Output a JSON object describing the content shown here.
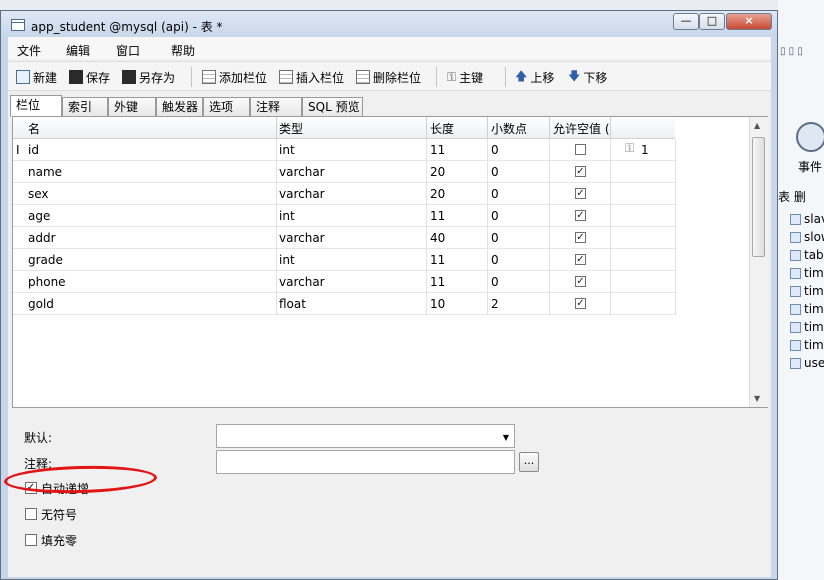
{
  "window": {
    "title": "app_student @mysql (api) - 表 *"
  },
  "window_controls": {
    "min": "—",
    "max": "□",
    "close": "×"
  },
  "menu": [
    "文件",
    "编辑",
    "窗口",
    "帮助"
  ],
  "toolbar": {
    "new": "新建",
    "save": "保存",
    "save_as": "另存为",
    "add_field": "添加栏位",
    "insert_field": "插入栏位",
    "delete_field": "删除栏位",
    "primary_key": "主键",
    "move_up": "上移",
    "move_down": "下移"
  },
  "tabs": [
    "栏位",
    "索引",
    "外键",
    "触发器",
    "选项",
    "注释",
    "SQL 预览"
  ],
  "active_tab": "栏位",
  "grid": {
    "columns": [
      "名",
      "类型",
      "长度",
      "小数点",
      "允许空值 ("
    ],
    "rows": [
      {
        "name": "id",
        "type": "int",
        "length": "11",
        "decimals": "0",
        "allow_null": false,
        "key": "1"
      },
      {
        "name": "name",
        "type": "varchar",
        "length": "20",
        "decimals": "0",
        "allow_null": true,
        "key": ""
      },
      {
        "name": "sex",
        "type": "varchar",
        "length": "20",
        "decimals": "0",
        "allow_null": true,
        "key": ""
      },
      {
        "name": "age",
        "type": "int",
        "length": "11",
        "decimals": "0",
        "allow_null": true,
        "key": ""
      },
      {
        "name": "addr",
        "type": "varchar",
        "length": "40",
        "decimals": "0",
        "allow_null": true,
        "key": ""
      },
      {
        "name": "grade",
        "type": "int",
        "length": "11",
        "decimals": "0",
        "allow_null": true,
        "key": ""
      },
      {
        "name": "phone",
        "type": "varchar",
        "length": "11",
        "decimals": "0",
        "allow_null": true,
        "key": ""
      },
      {
        "name": "gold",
        "type": "float",
        "length": "10",
        "decimals": "2",
        "allow_null": true,
        "key": ""
      }
    ]
  },
  "properties": {
    "default_label": "默认:",
    "default_value": "",
    "comment_label": "注释:",
    "comment_value": "",
    "comment_button": "...",
    "auto_increment": {
      "label": "自动递增",
      "checked": true
    },
    "unsigned": {
      "label": "无符号",
      "checked": false
    },
    "zerofill": {
      "label": "填充零",
      "checked": false
    }
  },
  "background_app": {
    "events_label": "事件",
    "side_tabs": "表  删",
    "list": [
      "slave_",
      "slow_",
      "tables",
      "time_z",
      "time_z",
      "time_z",
      "time_z",
      "time_z",
      "user"
    ]
  },
  "colors": {
    "highlight": "#e31414"
  }
}
